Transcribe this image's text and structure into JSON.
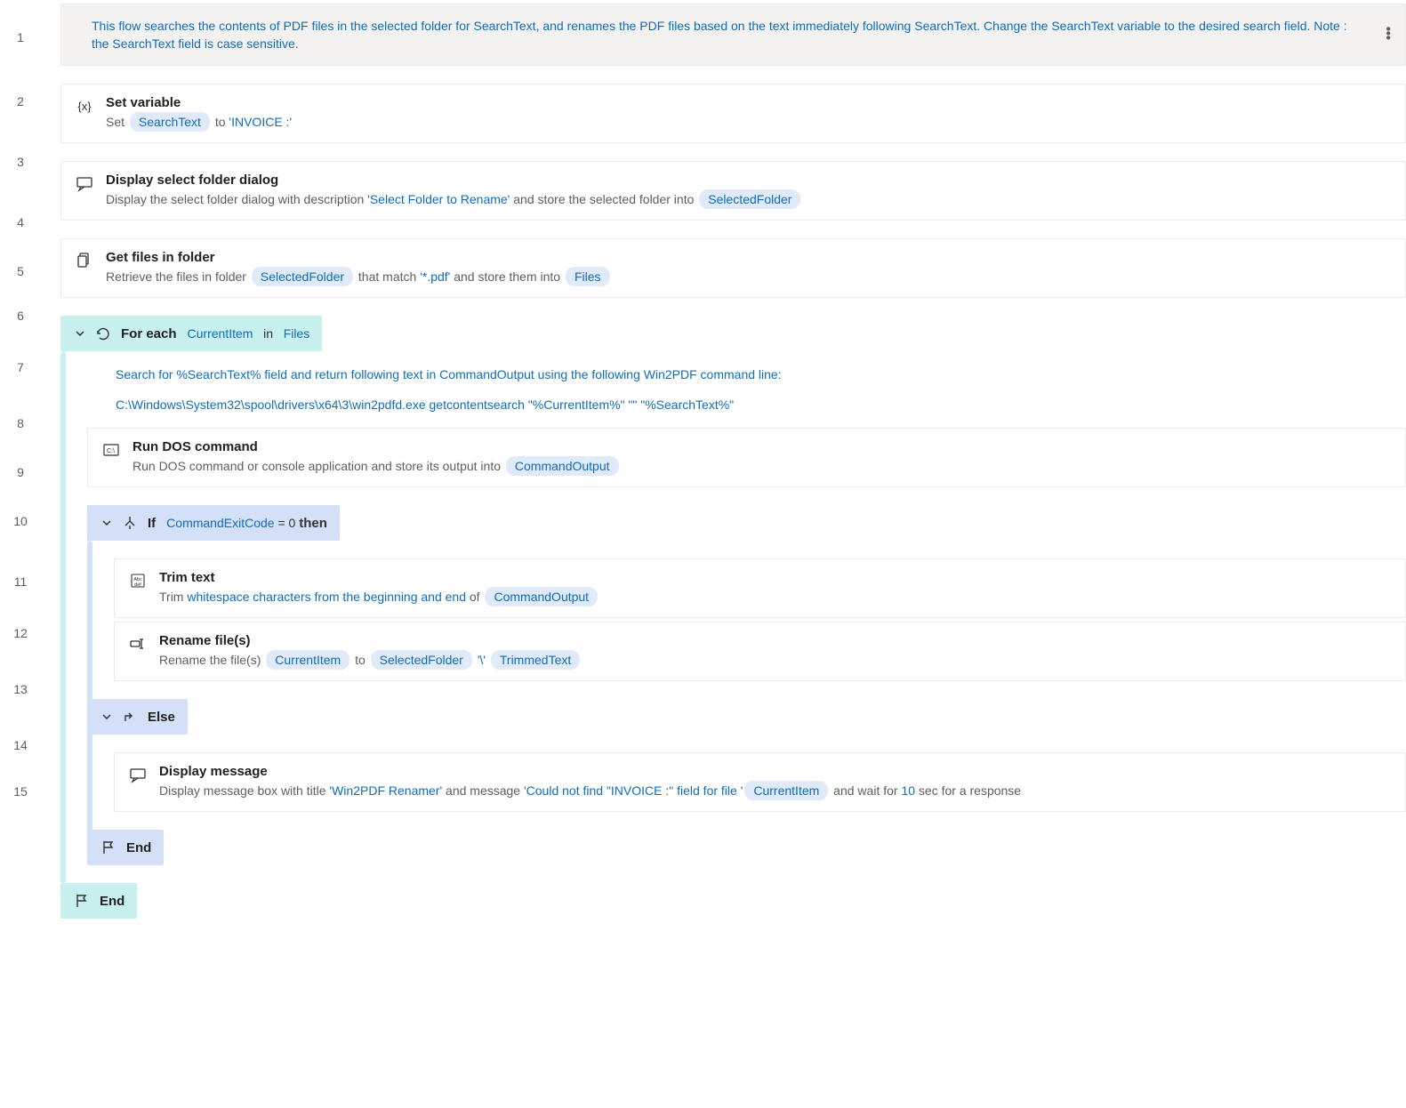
{
  "comment_header": "This flow searches the contents of PDF files in the selected folder for SearchText, and renames the PDF files based on the text immediately following SearchText.  Change the SearchText variable to the desired search field.  Note : the SearchText field is case sensitive.",
  "steps": {
    "setvar": {
      "title": "Set variable",
      "pre": "Set ",
      "var": "SearchText",
      "mid": " to ",
      "val": "'INVOICE :'"
    },
    "selectfolder": {
      "title": "Display select folder dialog",
      "pre": "Display the select folder dialog with description ",
      "desc": "'Select Folder to Rename'",
      "mid": " and store the selected folder into ",
      "var": "SelectedFolder"
    },
    "getfiles": {
      "title": "Get files in folder",
      "pre": "Retrieve the files in folder ",
      "var1": "SelectedFolder",
      "mid1": " that match ",
      "pattern": "'*.pdf'",
      "mid2": " and store them into ",
      "var2": "Files"
    },
    "foreach": {
      "title": "For each",
      "item": "CurrentItem",
      "in": "in",
      "list": "Files"
    },
    "inner_comment1": "Search for %SearchText% field and return following text in CommandOutput using the following Win2PDF command line:",
    "inner_comment2": "C:\\Windows\\System32\\spool\\drivers\\x64\\3\\win2pdfd.exe getcontentsearch \"%CurrentItem%\" \"\" \"%SearchText%\"",
    "rundos": {
      "title": "Run DOS command",
      "pre": "Run DOS command or console application and store its output into ",
      "var": "CommandOutput"
    },
    "ifblk": {
      "title": "If",
      "var": "CommandExitCode",
      "cond": " = 0 ",
      "then": "then"
    },
    "trim": {
      "title": "Trim text",
      "pre": "Trim ",
      "what": "whitespace characters from the beginning and end",
      "mid": " of ",
      "var": "CommandOutput"
    },
    "rename": {
      "title": "Rename file(s)",
      "pre": "Rename the file(s) ",
      "var1": "CurrentItem",
      "mid1": " to ",
      "var2": "SelectedFolder",
      "sep": "'\\'",
      "var3": "TrimmedText"
    },
    "elseblk": {
      "title": "Else"
    },
    "displaymsg": {
      "title": "Display message",
      "pre": "Display message box with title ",
      "msgtitle": "'Win2PDF Renamer'",
      "mid1": " and message ",
      "msg": "'Could not find \"INVOICE :\" field for file '",
      "var": "CurrentItem",
      "mid2": " and wait for ",
      "secs": "10",
      "post": " sec for a response"
    },
    "end1": "End",
    "end2": "End"
  },
  "lines": [
    "1",
    "2",
    "3",
    "4",
    "5",
    "6",
    "7",
    "8",
    "9",
    "10",
    "11",
    "12",
    "13",
    "14",
    "15"
  ]
}
